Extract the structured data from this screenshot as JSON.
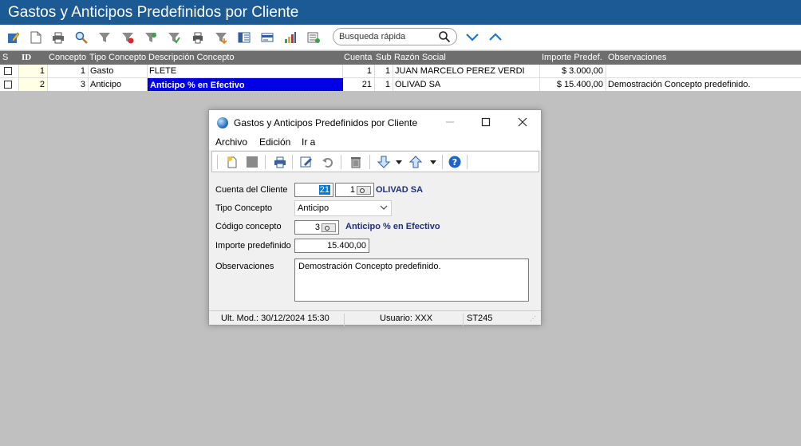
{
  "window": {
    "title": "Gastos y Anticipos Predefinidos por Cliente"
  },
  "toolbar": {
    "icons": [
      "edit-icon",
      "new-document-icon",
      "print-icon",
      "search-icon",
      "filter-icon",
      "filter-clear-icon",
      "filter-add-icon",
      "filter-check-icon",
      "print-preview-icon",
      "export-icon",
      "columns-icon",
      "card-icon",
      "chart-icon",
      "settings-icon"
    ],
    "search_placeholder": "Busqueda rápida"
  },
  "grid": {
    "columns": {
      "s": "S",
      "id": "ID",
      "concepto": "Concepto",
      "tipo": "Tipo Concepto",
      "desc": "Descripción Concepto",
      "cuenta": "Cuenta",
      "sub": "Sub",
      "razon": "Razón Social",
      "importe": "Importe Predef.",
      "obs": "Observaciones"
    },
    "rows": [
      {
        "id": "1",
        "concepto": "1",
        "tipo": "Gasto",
        "desc": "FLETE",
        "cuenta": "1",
        "sub": "1",
        "razon": "JUAN MARCELO PEREZ VERDI",
        "importe": "$ 3.000,00",
        "obs": ""
      },
      {
        "id": "2",
        "concepto": "3",
        "tipo": "Anticipo",
        "desc": "Anticipo % en Efectivo",
        "cuenta": "21",
        "sub": "1",
        "razon": "OLIVAD SA",
        "importe": "$ 15.400,00",
        "obs": "Demostración Concepto predefinido."
      }
    ]
  },
  "dialog": {
    "title": "Gastos y Anticipos Predefinidos por Cliente",
    "menu": {
      "archivo": "Archivo",
      "edicion": "Edición",
      "ira": "Ir a"
    },
    "form": {
      "cuenta_label": "Cuenta del Cliente",
      "cuenta_value": "21",
      "sub_value": "1",
      "cliente_name": "OLIVAD SA",
      "tipo_label": "Tipo Concepto",
      "tipo_value": "Anticipo",
      "codigo_label": "Código concepto",
      "codigo_value": "3",
      "codigo_desc": "Anticipo % en Efectivo",
      "importe_label": "Importe predefinido",
      "importe_value": "15.400,00",
      "obs_label": "Observaciones",
      "obs_value": "Demostración Concepto predefinido."
    },
    "status": {
      "mod": "Ult. Mod.: 30/12/2024 15:30",
      "user": "Usuario: XXX",
      "code": "ST245"
    }
  },
  "colors": {
    "titlebar": "#1c5a96",
    "header": "#6e6e6e",
    "selection": "#0000e6",
    "accent": "#1f78c8",
    "navy_text": "#1f2f7a"
  }
}
